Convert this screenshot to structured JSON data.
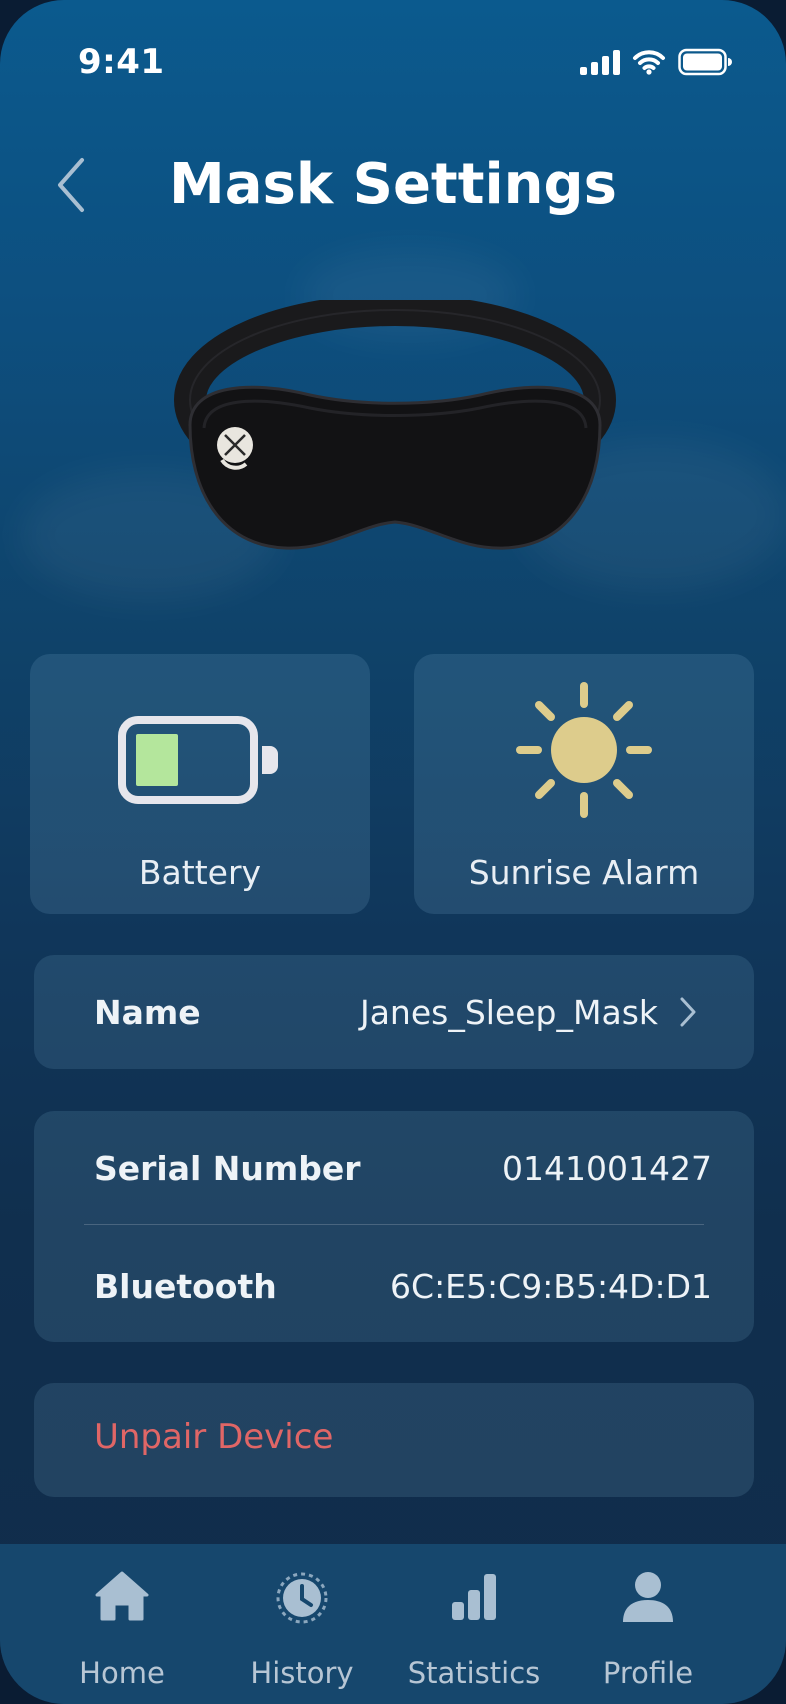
{
  "status_bar": {
    "time": "9:41"
  },
  "header": {
    "title": "Mask Settings"
  },
  "tiles": {
    "battery": {
      "label": "Battery",
      "level_fraction": 0.4,
      "fill_color": "#b4e69c"
    },
    "sunrise": {
      "label": "Sunrise Alarm",
      "sun_color": "#ddcc8c"
    }
  },
  "device": {
    "name_label": "Name",
    "name_value": "Janes_Sleep_Mask",
    "serial_label": "Serial Number",
    "serial_value": "0141001427",
    "bluetooth_label": "Bluetooth",
    "bluetooth_value": "6C:E5:C9:B5:4D:D1"
  },
  "actions": {
    "unpair_label": "Unpair Device",
    "unpair_color": "#e06666"
  },
  "tabbar": {
    "items": [
      {
        "label": "Home",
        "icon": "home-icon"
      },
      {
        "label": "History",
        "icon": "history-icon"
      },
      {
        "label": "Statistics",
        "icon": "statistics-icon"
      },
      {
        "label": "Profile",
        "icon": "profile-icon"
      }
    ]
  }
}
